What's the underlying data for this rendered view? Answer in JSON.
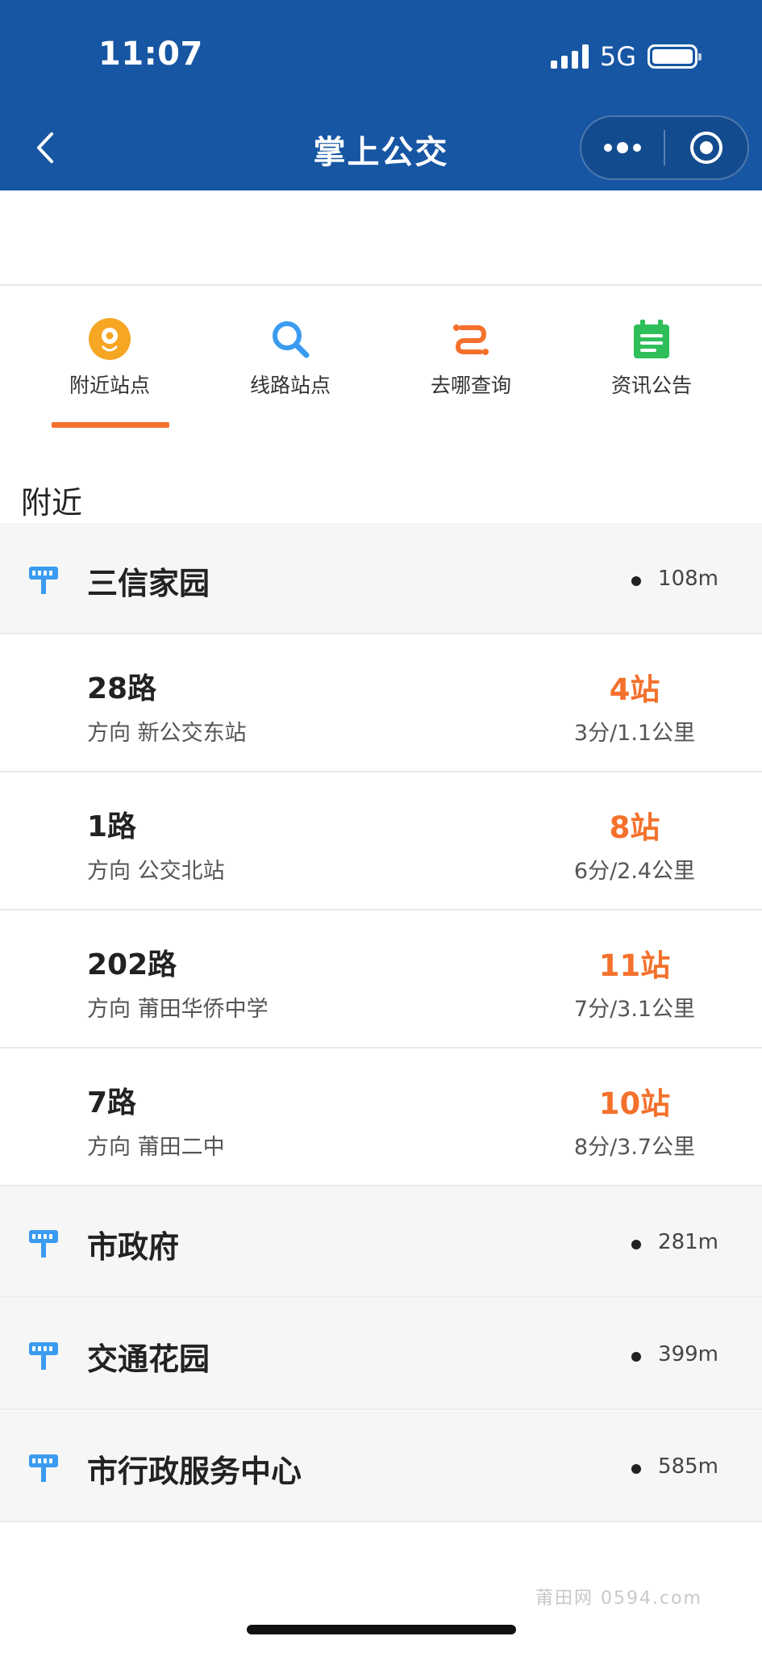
{
  "status_bar": {
    "time": "11:07",
    "network": "5G"
  },
  "nav": {
    "title": "掌上公交"
  },
  "tabs": [
    {
      "label": "附近站点",
      "icon": "location-pin-icon",
      "color": "#f6a623",
      "active": true
    },
    {
      "label": "线路站点",
      "icon": "search-icon",
      "color": "#3a9bf0",
      "active": false
    },
    {
      "label": "去哪查询",
      "icon": "route-icon",
      "color": "#f4712c",
      "active": false
    },
    {
      "label": "资讯公告",
      "icon": "notice-board-icon",
      "color": "#2fbf5a",
      "active": false
    }
  ],
  "section_title": "附近",
  "stops": [
    {
      "name": "三信家园",
      "distance": "108m"
    },
    {
      "name": "市政府",
      "distance": "281m"
    },
    {
      "name": "交通花园",
      "distance": "399m"
    },
    {
      "name": "市行政服务中心",
      "distance": "585m"
    }
  ],
  "routes": [
    {
      "name": "28路",
      "direction": "方向 新公交东站",
      "stops": "4站",
      "eta": "3分/1.1公里"
    },
    {
      "name": "1路",
      "direction": "方向 公交北站",
      "stops": "8站",
      "eta": "6分/2.4公里"
    },
    {
      "name": "202路",
      "direction": "方向 莆田华侨中学",
      "stops": "11站",
      "eta": "7分/3.1公里"
    },
    {
      "name": "7路",
      "direction": "方向 莆田二中",
      "stops": "10站",
      "eta": "8分/3.7公里"
    }
  ],
  "watermark": "莆田网 0594.com",
  "colors": {
    "header": "#1656a3",
    "accent": "#f4712c",
    "stop_icon": "#3a9bf0"
  }
}
